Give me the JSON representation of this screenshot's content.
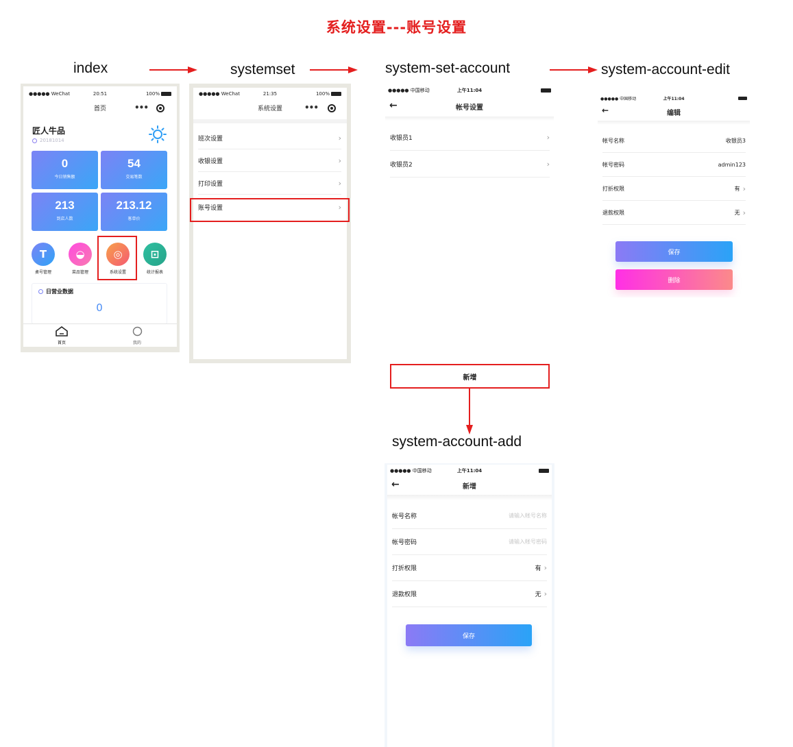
{
  "title": "系统设置---账号设置",
  "labels": {
    "index": "index",
    "systemset": "systemset",
    "account": "system-set-account",
    "edit": "system-account-edit",
    "add": "system-account-add"
  },
  "index_screen": {
    "status": {
      "carrier": "●●●●● WeChat",
      "time": "20:51",
      "battery": "100%"
    },
    "nav_title": "首页",
    "nav_dots": "•••",
    "store_name": "匠人牛品",
    "store_date": "20181014",
    "stats": [
      {
        "value": "0",
        "caption": "今日销售额"
      },
      {
        "value": "54",
        "caption": "交易笔数"
      },
      {
        "value": "213",
        "caption": "到店人数"
      },
      {
        "value": "213.12",
        "caption": "客单价"
      }
    ],
    "icons": [
      {
        "glyph": "T",
        "caption": "桌号管理",
        "color": "#4f8df5"
      },
      {
        "glyph": "◒",
        "caption": "菜品管理",
        "color": "#f24bd0"
      },
      {
        "glyph": "◎",
        "caption": "系统设置",
        "color": "#f77a4a"
      },
      {
        "glyph": "⊡",
        "caption": "统计报表",
        "color": "#2fb89a"
      }
    ],
    "daily_title": "日营业数据",
    "daily_value": "0",
    "tabs": [
      {
        "label": "首页"
      },
      {
        "label": "我的"
      }
    ]
  },
  "systemset_screen": {
    "status": {
      "carrier": "●●●●● WeChat",
      "time": "21:35",
      "battery": "100%"
    },
    "nav_title": "系统设置",
    "nav_dots": "•••",
    "items": [
      {
        "label": "班次设置"
      },
      {
        "label": "收银设置"
      },
      {
        "label": "打印设置"
      },
      {
        "label": "账号设置"
      }
    ]
  },
  "account_screen": {
    "status": {
      "carrier": "●●●●● 中国移动",
      "time": "上午11:04"
    },
    "nav_title": "帐号设置",
    "items": [
      {
        "label": "收银员1"
      },
      {
        "label": "收银员2"
      }
    ]
  },
  "edit_screen": {
    "status": {
      "carrier": "●●●●● 中国移动",
      "time": "上午11:04"
    },
    "nav_title": "编辑",
    "fields": [
      {
        "label": "帐号名称",
        "value": "收银员3"
      },
      {
        "label": "帐号密码",
        "value": "admin123"
      },
      {
        "label": "打折权限",
        "value": "有"
      },
      {
        "label": "退款权限",
        "value": "无"
      }
    ],
    "save_label": "保存",
    "delete_label": "删除"
  },
  "add_trigger_label": "新增",
  "add_screen": {
    "status": {
      "carrier": "●●●●● 中国移动",
      "time": "上午11:04"
    },
    "nav_title": "新增",
    "fields": [
      {
        "label": "帐号名称",
        "placeholder": "请输入帐号名称"
      },
      {
        "label": "帐号密码",
        "placeholder": "请输入帐号密码"
      },
      {
        "label": "打折权限",
        "value": "有"
      },
      {
        "label": "退款权限",
        "value": "无"
      }
    ],
    "save_label": "保存"
  }
}
